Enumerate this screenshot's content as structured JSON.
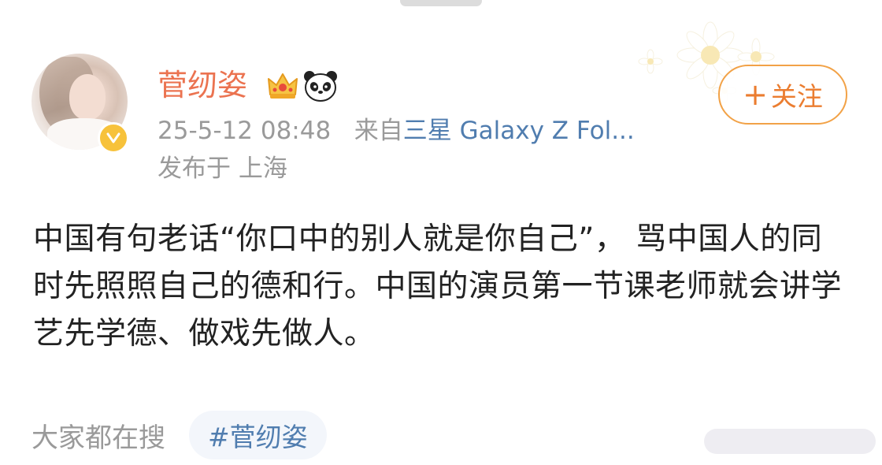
{
  "author": {
    "name": "菅纫姿",
    "badges": [
      "crown-icon",
      "panda-icon"
    ],
    "verified_icon": "verified-v-icon"
  },
  "meta": {
    "timestamp": "25-5-12 08:48",
    "from_prefix": "来自",
    "source": "三星 Galaxy Z Fol...",
    "location": "发布于 上海"
  },
  "follow": {
    "icon": "+",
    "label": "关注"
  },
  "post": {
    "text": "中国有句老话“你口中的别人就是你自己”， 骂中国人的同时先照照自己的德和行。中国的演员第一节课老师就会讲学艺先学德、做戏先做人。"
  },
  "trending": {
    "label": "大家都在搜",
    "tag": "#菅纫姿"
  },
  "colors": {
    "name": "#eb7350",
    "link": "#507daf",
    "follow_border": "#f2a247",
    "meta": "#9a9a9a"
  }
}
